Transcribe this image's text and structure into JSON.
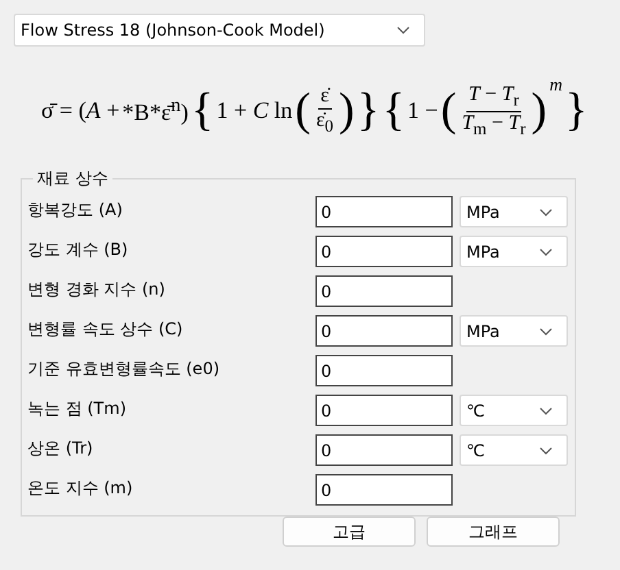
{
  "model_select": {
    "value": "Flow Stress 18 (Johnson-Cook Model)"
  },
  "formula": [
    {
      "kind": "text",
      "text": "σ̄ = (*A* +"
    },
    {
      "kind": "text",
      "text": "*B*ε̄$^{n}$)"
    },
    {
      "kind": "delim",
      "text": "{"
    },
    {
      "kind": "text",
      "text": "1 + *C* ln"
    },
    {
      "kind": "delim",
      "text": "("
    },
    {
      "kind": "fraction",
      "numerator": "ε̇",
      "denominator": "ε̇$_{0}$"
    },
    {
      "kind": "delim",
      "text": ")"
    },
    {
      "kind": "delim",
      "text": "}"
    },
    {
      "kind": "delim",
      "text": "{"
    },
    {
      "kind": "text",
      "text": "1 −"
    },
    {
      "kind": "delim",
      "text": "("
    },
    {
      "kind": "fraction",
      "numerator": "*T* − *T*$_{r}$",
      "denominator": "*T*$_{m}$ − *T*$_{r}$"
    },
    {
      "kind": "delim",
      "text": ")"
    },
    {
      "kind": "sup",
      "text": "m"
    },
    {
      "kind": "delim",
      "text": "}"
    }
  ],
  "group": {
    "title": "재료 상수",
    "rows": [
      {
        "label": "항복강도 (A)",
        "value": "0",
        "unit": "MPa"
      },
      {
        "label": "강도 계수 (B)",
        "value": "0",
        "unit": "MPa"
      },
      {
        "label": "변형 경화 지수 (n)",
        "value": "0"
      },
      {
        "label": "변형률 속도 상수 (C)",
        "value": "0",
        "unit": "MPa"
      },
      {
        "label": "기준 유효변형률속도 (e0)",
        "value": "0"
      },
      {
        "label": "녹는 점 (Tm)",
        "value": "0",
        "unit": "℃"
      },
      {
        "label": "상온 (Tr)",
        "value": "0",
        "unit": "℃"
      },
      {
        "label": "온도 지수 (m)",
        "value": "0"
      }
    ]
  },
  "buttons": [
    "고급",
    "그래프"
  ]
}
